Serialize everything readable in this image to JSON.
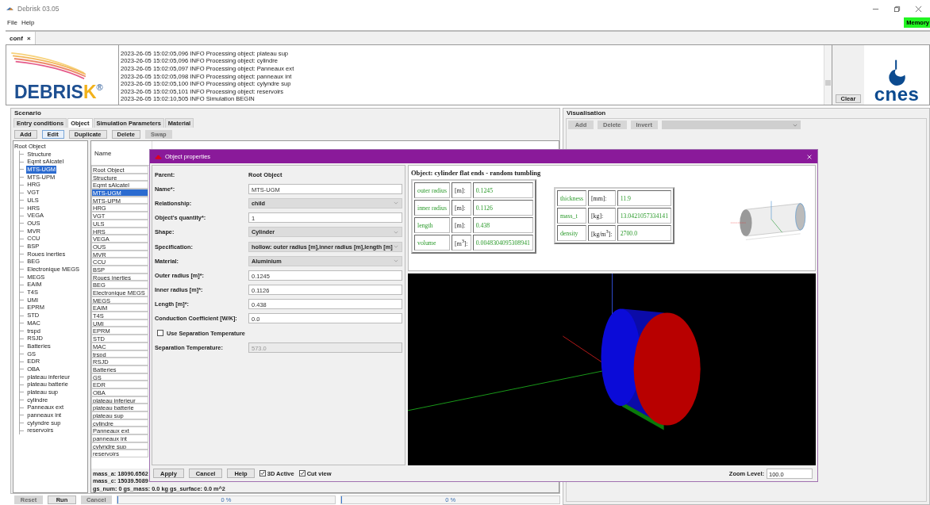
{
  "window": {
    "title": "Debrisk 03.05"
  },
  "menu": [
    "File",
    "Help"
  ],
  "memory_badge": "Memory",
  "document_tabs": [
    {
      "label": "conf",
      "close": "×",
      "selected": true
    }
  ],
  "logo": {
    "name": "DEBRIS",
    "accent": "K",
    "mark": "®"
  },
  "log": {
    "lines": [
      "2023-26-05 15:02:05,096 INFO Processing object: plateau sup",
      "2023-26-05 15:02:05,096 INFO Processing object: cylindre",
      "2023-26-05 15:02:05,097 INFO Processing object: Panneaux ext",
      "2023-26-05 15:02:05,098 INFO Processing object: panneaux int",
      "2023-26-05 15:02:05,100 INFO Processing object: cylyndre sup",
      "2023-26-05 15:02:05,101 INFO Processing object: reservoirs",
      "2023-26-05 15:02:10,505 INFO Simulation BEGIN"
    ],
    "clear_button": "Clear"
  },
  "agency_logo": "cnes",
  "scenario": {
    "title": "Scenario",
    "tabs": [
      {
        "label": "Entry conditions",
        "selected": false
      },
      {
        "label": "Object",
        "selected": true
      },
      {
        "label": "Simulation Parameters",
        "selected": false
      },
      {
        "label": "Material",
        "selected": false
      }
    ],
    "buttons": [
      {
        "label": "Add",
        "disabled": false,
        "focused": false
      },
      {
        "label": "Edit",
        "disabled": false,
        "focused": true
      },
      {
        "label": "Duplicate",
        "disabled": false,
        "focused": false
      },
      {
        "label": "Delete",
        "disabled": false,
        "focused": false
      },
      {
        "label": "Swap",
        "disabled": true,
        "focused": false
      }
    ],
    "tree": [
      {
        "label": "Root Object",
        "selected": false,
        "children": [
          {
            "label": "Structure",
            "selected": false
          },
          {
            "label": "Eqmt sAlcatel",
            "selected": false
          },
          {
            "label": "MTS-UGM",
            "selected": true
          },
          {
            "label": "MTS-UPM",
            "selected": false
          },
          {
            "label": "HRG",
            "selected": false
          },
          {
            "label": "VGT",
            "selected": false
          },
          {
            "label": "ULS",
            "selected": false
          },
          {
            "label": "HRS",
            "selected": false
          },
          {
            "label": "VEGA",
            "selected": false
          },
          {
            "label": "OUS",
            "selected": false
          },
          {
            "label": "MVR",
            "selected": false
          },
          {
            "label": "CCU",
            "selected": false
          },
          {
            "label": "BSP",
            "selected": false
          },
          {
            "label": "Roues inerties",
            "selected": false
          },
          {
            "label": "BEG",
            "selected": false
          },
          {
            "label": "Electronique MEGS",
            "selected": false
          },
          {
            "label": "MEGS",
            "selected": false
          },
          {
            "label": "EAIM",
            "selected": false
          },
          {
            "label": "T4S",
            "selected": false
          },
          {
            "label": "UMI",
            "selected": false
          },
          {
            "label": "EPRM",
            "selected": false
          },
          {
            "label": "STD",
            "selected": false
          },
          {
            "label": "MAC",
            "selected": false
          },
          {
            "label": "trspd",
            "selected": false
          },
          {
            "label": "RSJD",
            "selected": false
          },
          {
            "label": "Batteries",
            "selected": false
          },
          {
            "label": "GS",
            "selected": false
          },
          {
            "label": "EDR",
            "selected": false
          },
          {
            "label": "OBA",
            "selected": false
          },
          {
            "label": "plateau inferieur",
            "selected": false
          },
          {
            "label": "plateau batterie",
            "selected": false
          },
          {
            "label": "plateau sup",
            "selected": false
          },
          {
            "label": "cylindre",
            "selected": false
          },
          {
            "label": "Panneaux ext",
            "selected": false
          },
          {
            "label": "panneaux int",
            "selected": false
          },
          {
            "label": "cylyndre sup",
            "selected": false
          },
          {
            "label": "reservoirs",
            "selected": false
          }
        ]
      }
    ],
    "table": {
      "columns": [
        "Name"
      ],
      "rows": [
        {
          "name": "Root Object",
          "selected": false
        },
        {
          "name": "Structure",
          "selected": false
        },
        {
          "name": "Eqmt sAlcatel",
          "selected": false
        },
        {
          "name": "MTS-UGM",
          "selected": true
        },
        {
          "name": "MTS-UPM",
          "selected": false
        },
        {
          "name": "HRG",
          "selected": false
        },
        {
          "name": "VGT",
          "selected": false
        },
        {
          "name": "ULS",
          "selected": false
        },
        {
          "name": "HRS",
          "selected": false
        },
        {
          "name": "VEGA",
          "selected": false
        },
        {
          "name": "OUS",
          "selected": false
        },
        {
          "name": "MVR",
          "selected": false
        },
        {
          "name": "CCU",
          "selected": false
        },
        {
          "name": "BSP",
          "selected": false
        },
        {
          "name": "Roues inerties",
          "selected": false
        },
        {
          "name": "BEG",
          "selected": false
        },
        {
          "name": "Electronique MEGS",
          "selected": false
        },
        {
          "name": "MEGS",
          "selected": false
        },
        {
          "name": "EAIM",
          "selected": false
        },
        {
          "name": "T4S",
          "selected": false
        },
        {
          "name": "UMI",
          "selected": false
        },
        {
          "name": "EPRM",
          "selected": false
        },
        {
          "name": "STD",
          "selected": false
        },
        {
          "name": "MAC",
          "selected": false
        },
        {
          "name": "trspd",
          "selected": false
        },
        {
          "name": "RSJD",
          "selected": false
        },
        {
          "name": "Batteries",
          "selected": false
        },
        {
          "name": "GS",
          "selected": false
        },
        {
          "name": "EDR",
          "selected": false
        },
        {
          "name": "OBA",
          "selected": false
        },
        {
          "name": "plateau inferieur",
          "selected": false
        },
        {
          "name": "plateau batterie",
          "selected": false
        },
        {
          "name": "plateau sup",
          "selected": false
        },
        {
          "name": "cylindre",
          "selected": false
        },
        {
          "name": "Panneaux ext",
          "selected": false
        },
        {
          "name": "panneaux int",
          "selected": false
        },
        {
          "name": "cylyndre sup",
          "selected": false
        },
        {
          "name": "reservoirs",
          "selected": false
        }
      ]
    },
    "summary": [
      "mass_a: 18090.6562",
      "mass_c: 15039.5089",
      "gs_num: 0 gs_mass: 0.0 kg gs_surface: 0.0 m^2"
    ]
  },
  "run_buttons": [
    {
      "label": "Reset",
      "disabled": true
    },
    {
      "label": "Run",
      "disabled": false
    },
    {
      "label": "Cancel",
      "disabled": true
    }
  ],
  "progress": [
    {
      "level": 0,
      "reading": "0 %"
    },
    {
      "level": 0,
      "reading": "0 %"
    }
  ],
  "visualisation": {
    "title": "Visualisation",
    "buttons": [
      {
        "label": "Add",
        "disabled": true
      },
      {
        "label": "Delete",
        "disabled": true
      },
      {
        "label": "Invert",
        "disabled": true
      }
    ],
    "dropdown": {
      "disabled": true
    }
  },
  "dialog": {
    "title": "Object properties",
    "fields": [
      {
        "kind": "static",
        "label": "Parent:",
        "value": "Root Object"
      },
      {
        "kind": "text",
        "label": "Name*:",
        "value": "MTS-UGM",
        "disabled": false
      },
      {
        "kind": "select",
        "label": "Relationship:",
        "value": "child"
      },
      {
        "kind": "text",
        "label": "Object's quantity*:",
        "value": "1",
        "disabled": false
      },
      {
        "kind": "select",
        "label": "Shape:",
        "value": "Cylinder"
      },
      {
        "kind": "select",
        "label": "Specification:",
        "value": "hollow: outer radius [m],inner radius [m],length [m]"
      },
      {
        "kind": "select",
        "label": "Material:",
        "value": "Aluminium"
      },
      {
        "kind": "text",
        "label": "Outer radius [m]*:",
        "value": "0.1245",
        "disabled": false
      },
      {
        "kind": "text",
        "label": "Inner radius [m]*:",
        "value": "0.1126",
        "disabled": false
      },
      {
        "kind": "text",
        "label": "Length [m]*:",
        "value": "0.438",
        "disabled": false
      },
      {
        "kind": "text",
        "label": "Conduction Coefficient [W/K]:",
        "value": "0.0",
        "disabled": false
      },
      {
        "kind": "checkbox",
        "label": "Use Separation Temperature",
        "checked": false
      },
      {
        "kind": "text",
        "label": "Separation Temperature:",
        "value": "573.0",
        "disabled": true
      }
    ],
    "info": {
      "heading": "Object: cylinder flat ends - random tumbling",
      "tables": [
        [
          {
            "name": "outer radius",
            "unit": "[m]:",
            "value": "0.1245"
          },
          {
            "name": "inner radius",
            "unit": "[m]:",
            "value": "0.1126"
          },
          {
            "name": "length",
            "unit": "[m]:",
            "value": "0.438"
          },
          {
            "name": "volume",
            "unit": "[m$^{3}$]:",
            "value": "0.0048304095308941"
          }
        ],
        [
          {
            "name": "thickness",
            "unit": "[mm]:",
            "value": "11.9"
          },
          {
            "name": "mass_t",
            "unit": "[kg]:",
            "value": "13.0421057334141"
          },
          {
            "name": "density",
            "unit": "[kg/m$^{3}$]:",
            "value": "2700.0"
          }
        ]
      ]
    },
    "actions": [
      "Apply",
      "Cancel",
      "Help"
    ],
    "toggles": [
      {
        "label": "3D Active",
        "checked": true
      },
      {
        "label": "Cut view",
        "checked": true
      }
    ],
    "zoom": {
      "label": "Zoom Level:",
      "value": "100.0"
    }
  }
}
